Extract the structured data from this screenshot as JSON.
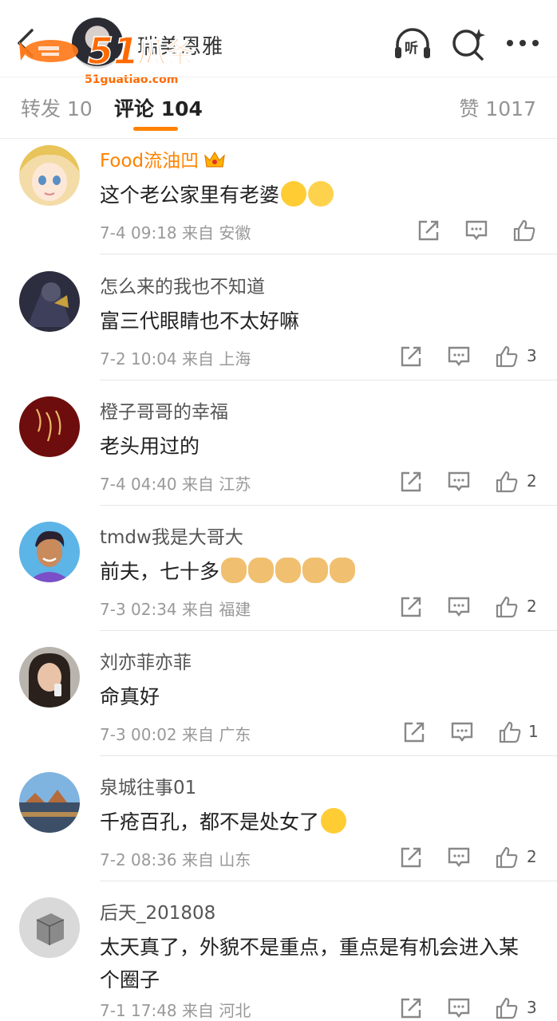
{
  "header": {
    "author_name": "瑞美恩雅",
    "logo_text": "51瓜条",
    "logo_url_text": "51guatiao.com",
    "icons": [
      "back-icon",
      "listen-icon",
      "search-icon",
      "more-icon"
    ],
    "listen_label": "听"
  },
  "tabs": {
    "repost": "转发 10",
    "comment": "评论 104",
    "like": "赞 1017"
  },
  "comments": [
    {
      "name": "Food流油凹",
      "text": "这个老公家里有老婆",
      "time": "7-4 09:18",
      "from": "来自 安徽",
      "likes": ""
    },
    {
      "name": "怎么来的我也不知道",
      "text": "富三代眼睛也不太好嘛",
      "time": "7-2 10:04",
      "from": "来自 上海",
      "likes": "3"
    },
    {
      "name": "橙子哥哥的幸福",
      "text": "老头用过的",
      "time": "7-4 04:40",
      "from": "来自 江苏",
      "likes": "2"
    },
    {
      "name": "tmdw我是大哥大",
      "text": "前夫，七十多",
      "time": "7-3 02:34",
      "from": "来自 福建",
      "likes": "2"
    },
    {
      "name": "刘亦菲亦菲",
      "text": "命真好",
      "time": "7-3 00:02",
      "from": "来自 广东",
      "likes": "1"
    },
    {
      "name": "泉城往事01",
      "text": "千疮百孔，都不是处女了",
      "time": "7-2 08:36",
      "from": "来自 山东",
      "likes": "2"
    },
    {
      "name": "后天_201808",
      "text": "太天真了，外貌不是重点，重点是有机会进入某个圈子",
      "time": "7-1 17:48",
      "from": "来自 河北",
      "likes": "3"
    }
  ],
  "colors": {
    "accent": "#ff8200",
    "vip_name": "#ff8200",
    "muted": "#999999"
  }
}
